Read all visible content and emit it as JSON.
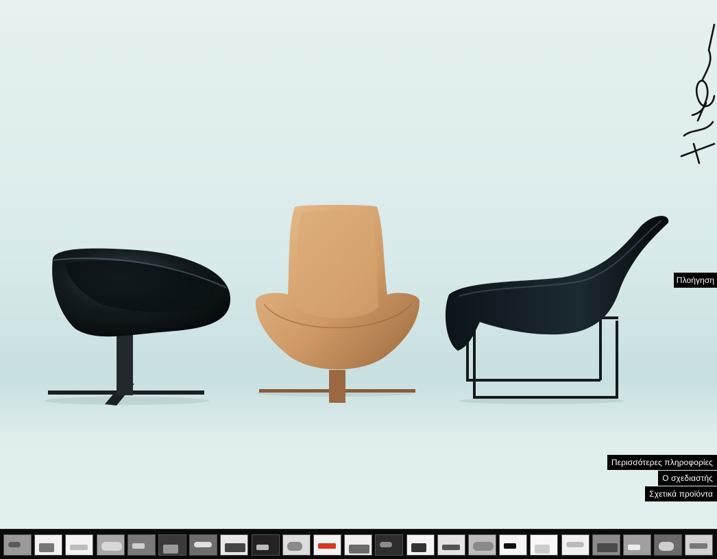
{
  "page": {
    "signature_alt": "Signature",
    "photo_alt": "Mart, Mart and Mart chairs"
  },
  "menu": {
    "navigation": "Πλοήγηση",
    "more_info": "Περισσότερες πληροφορίες",
    "designer": "Ο σχεδιαστής",
    "related_products": "Σχετικά προϊόντα"
  },
  "thumbnails": [
    {
      "name": "thumb-1",
      "bg": "#9a9a9a",
      "fg": "#5a5a5a"
    },
    {
      "name": "thumb-2",
      "bg": "#f2f2f2",
      "fg": "#777777"
    },
    {
      "name": "thumb-3",
      "bg": "#f4f4f4",
      "fg": "#bdbdbd"
    },
    {
      "name": "thumb-4",
      "bg": "#a8a8a8",
      "fg": "#d8d8d8"
    },
    {
      "name": "thumb-5",
      "bg": "#7a7a7a",
      "fg": "#cfcfcf"
    },
    {
      "name": "thumb-6",
      "bg": "#3a3a3a",
      "fg": "#9a9a9a"
    },
    {
      "name": "thumb-7",
      "bg": "#6d6d6d",
      "fg": "#e0e0e0"
    },
    {
      "name": "thumb-8",
      "bg": "#e8e8e8",
      "fg": "#444444"
    },
    {
      "name": "thumb-9",
      "bg": "#222222",
      "fg": "#bbbbbb"
    },
    {
      "name": "thumb-10",
      "bg": "#dddddd",
      "fg": "#8a8a8a"
    },
    {
      "name": "thumb-11",
      "bg": "#f3f3f3",
      "fg": "#d6381e"
    },
    {
      "name": "thumb-12",
      "bg": "#f0f0f0",
      "fg": "#6b6b6b"
    },
    {
      "name": "thumb-13",
      "bg": "#2e2e2e",
      "fg": "#8c8c8c"
    },
    {
      "name": "thumb-14",
      "bg": "#f5f5f5",
      "fg": "#333333"
    },
    {
      "name": "thumb-15",
      "bg": "#e4e4e4",
      "fg": "#555555"
    },
    {
      "name": "thumb-16",
      "bg": "#bdbdbd",
      "fg": "#8a8a8a"
    },
    {
      "name": "thumb-17",
      "bg": "#f6f6f6",
      "fg": "#111111"
    },
    {
      "name": "thumb-18",
      "bg": "#f8f8f8",
      "fg": "#cccccc"
    },
    {
      "name": "thumb-19",
      "bg": "#f1f1f1",
      "fg": "#bbbbbb"
    },
    {
      "name": "thumb-20",
      "bg": "#8c8c8c",
      "fg": "#4a4a4a"
    },
    {
      "name": "thumb-21",
      "bg": "#a0a0a0",
      "fg": "#ececec"
    },
    {
      "name": "thumb-22",
      "bg": "#6a6a6a",
      "fg": "#cfcfcf"
    },
    {
      "name": "thumb-23",
      "bg": "#d2d2d2",
      "fg": "#777777"
    }
  ]
}
